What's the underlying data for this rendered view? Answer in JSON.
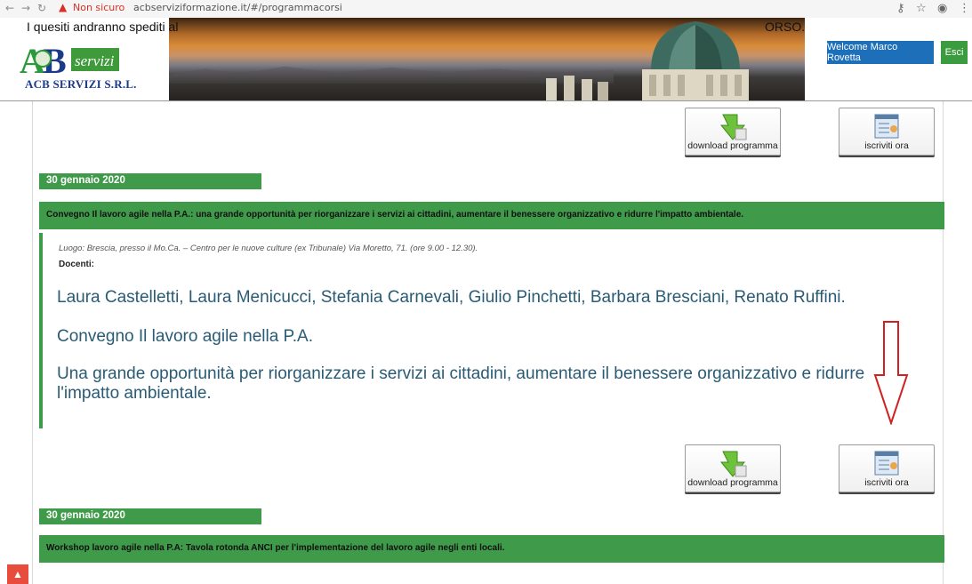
{
  "browser": {
    "nav_back": "←",
    "nav_forward": "→",
    "nav_reload": "↻",
    "security_label": "Non sicuro",
    "url": "acbserviziformazione.it/#/programmacorsi",
    "icon_key": "⚷",
    "icon_star": "☆",
    "icon_account": "◉",
    "icon_menu": "⋮"
  },
  "header": {
    "notice_left": "I quesiti andranno spediti al",
    "notice_right": "ORSO.",
    "logo_text": "ACB SERVIZI S.R.L.",
    "welcome_label": "Welcome Marco Rovetta",
    "exit_label": "Esci"
  },
  "buttons": {
    "download_label": "download programma",
    "subscribe_label": "iscriviti ora"
  },
  "events": [
    {
      "date": "30 gennaio 2020",
      "title": "Convegno Il lavoro agile nella P.A.: una grande opportunità per riorganizzare i servizi ai cittadini, aumentare il benessere organizzativo e ridurre l'impatto ambientale.",
      "luogo": "Luogo: Brescia, presso il Mo.Ca. – Centro per le nuove culture (ex Tribunale) Via Moretto, 71. (ore 9.00 - 12.30).",
      "docenti_label": "Docenti:",
      "docenti": "Laura Castelletti, Laura Menicucci, Stefania Carnevali, Giulio Pinchetti, Barbara Bresciani, Renato Ruffini.",
      "heading": "Convegno Il lavoro agile nella P.A.",
      "description": "Una grande opportunità per riorganizzare i servizi ai cittadini, aumentare il benessere organizzativo e ridurre l'impatto ambientale."
    },
    {
      "date": "30 gennaio 2020",
      "title": "Workshop lavoro agile nella P.A: Tavola rotonda ANCI per l'implementazione del lavoro agile negli enti locali."
    }
  ],
  "scroll_top_icon": "chevron-up-icon",
  "colors": {
    "green": "#3f9a4a",
    "blue_button": "#1c6fb8",
    "text_blue": "#2a5b74",
    "arrow_red": "#d02020"
  }
}
